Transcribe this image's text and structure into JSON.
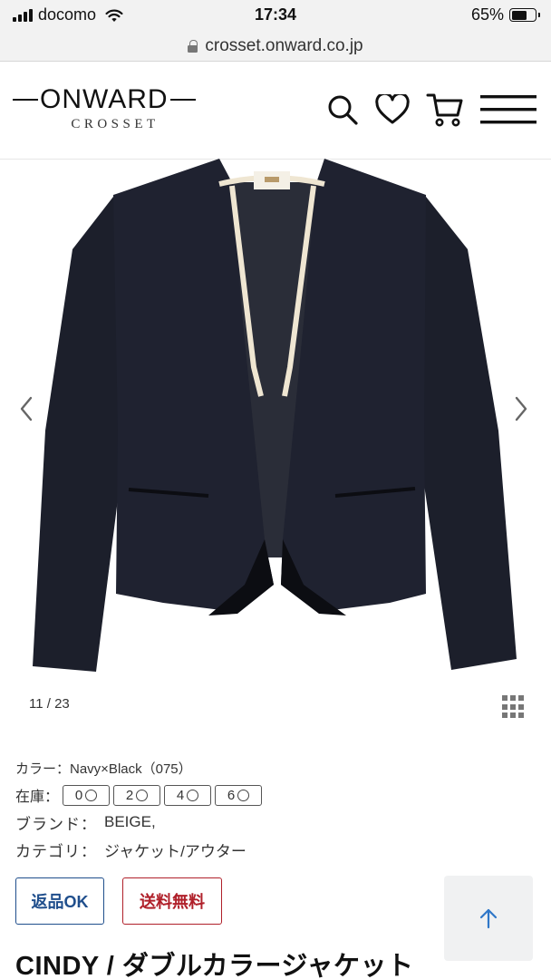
{
  "status_bar": {
    "carrier": "docomo",
    "time": "17:34",
    "battery": "65%",
    "battery_level": 0.65,
    "icons": [
      "signal-icon",
      "wifi-icon",
      "battery-icon"
    ]
  },
  "browser": {
    "url": "crosset.onward.co.jp",
    "icons": [
      "lock-icon"
    ]
  },
  "header": {
    "logo_main": "ONWARD",
    "logo_sub": "CROSSET",
    "icons": [
      "search-icon",
      "heart-icon",
      "cart-icon",
      "menu-icon"
    ]
  },
  "gallery": {
    "counter": "11 / 23",
    "icons": [
      "chevron-left-icon",
      "chevron-right-icon",
      "grid-icon"
    ],
    "product_colors": {
      "jacket": "#1c1f2b",
      "trim": "#efe6d2"
    }
  },
  "details": {
    "color_label": "カラー：Navy×Black（075）",
    "stock_label": "在庫：",
    "sizes": [
      {
        "size": "0"
      },
      {
        "size": "2"
      },
      {
        "size": "4"
      },
      {
        "size": "6"
      }
    ],
    "brand_key": "ブランド：",
    "brand_value": "BEIGE,",
    "category_key": "カテゴリ：",
    "category_value": "ジャケット/アウター"
  },
  "badges": {
    "returns": "返品OK",
    "shipping": "送料無料",
    "colors": {
      "returns": "#1f4e8c",
      "shipping": "#b0202a"
    }
  },
  "scroll_top": {
    "icon": "arrow-up-icon",
    "color": "#2f77c8"
  },
  "product": {
    "title": "CINDY / ダブルカラージャケット"
  }
}
